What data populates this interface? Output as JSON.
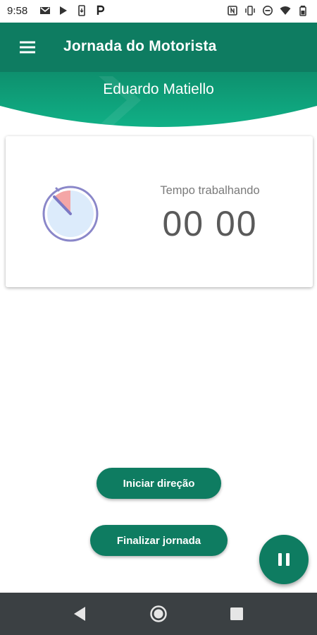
{
  "status_bar": {
    "time": "9:58",
    "left_icons": [
      "gmail-icon",
      "play-store-icon",
      "phone-update-icon",
      "parking-icon"
    ],
    "right_icons": [
      "nfc-icon",
      "vibrate-icon",
      "do-not-disturb-icon",
      "wifi-icon",
      "battery-icon"
    ]
  },
  "app_bar": {
    "title": "Jornada do Motorista",
    "menu_icon": "hamburger-menu-icon"
  },
  "header": {
    "user_name": "Eduardo Matiello"
  },
  "card": {
    "label": "Tempo trabalhando",
    "value": "00 00",
    "icon": "timer-icon"
  },
  "actions": {
    "start_label": "Iniciar direção",
    "end_label": "Finalizar jornada"
  },
  "fab": {
    "icon": "pause-icon"
  },
  "nav_bar": {
    "icons": [
      "back-icon",
      "home-icon",
      "recents-icon"
    ]
  },
  "colors": {
    "primary": "#0e7c61",
    "primary_light": "#12b38a",
    "nav_bar": "#3b4043",
    "timer_accent": "#f4a6a6",
    "timer_face": "#dcebfb"
  }
}
